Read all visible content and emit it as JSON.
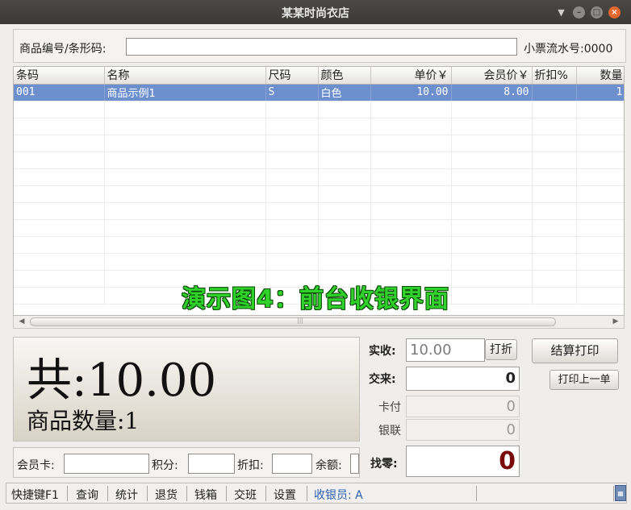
{
  "window": {
    "title": "某某时尚衣店"
  },
  "search": {
    "barcode_label": "商品编号/条形码:",
    "barcode_value": "",
    "receipt_label": "小票流水号:",
    "receipt_value": "0000"
  },
  "table": {
    "columns": [
      "条码",
      "名称",
      "尺码",
      "颜色",
      "单价￥",
      "会员价￥",
      "折扣%",
      "数量"
    ],
    "rows": [
      {
        "barcode": "001",
        "name": "商品示例1",
        "size": "S",
        "color": "白色",
        "price": "10.00",
        "member_price": "8.00",
        "discount": "",
        "qty": "1"
      }
    ]
  },
  "overlay_caption": "演示图4：前台收银界面",
  "summary": {
    "total_text": "共:10.00",
    "qty_text": "商品数量:1"
  },
  "payment": {
    "received_label": "实收:",
    "received_value": "10.00",
    "discount_button": "打折",
    "tendered_label": "交来:",
    "tendered_value": "0",
    "card_label": "卡付",
    "card_value": "0",
    "unionpay_label": "银联",
    "unionpay_value": "0",
    "change_label": "找零:",
    "change_value": "0",
    "change_color": "#7a0a0a",
    "checkout_button": "结算打印",
    "reprint_button": "打印上一单"
  },
  "member": {
    "card_label": "会员卡:",
    "points_label": "积分:",
    "discount_label": "折扣:",
    "balance_label": "余额:"
  },
  "toolbar": {
    "items": [
      "快捷键F1",
      "查询",
      "统计",
      "退货",
      "钱箱",
      "交班",
      "设置"
    ],
    "cashier": "收银员: A"
  },
  "icons": {
    "calculator": "calculator-icon",
    "menu": "dropdown-icon",
    "minimize": "minimize-icon",
    "maximize": "maximize-icon",
    "close": "close-icon"
  }
}
